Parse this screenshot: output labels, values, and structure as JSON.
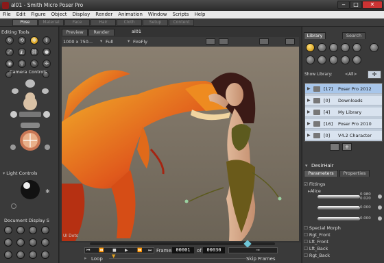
{
  "window": {
    "title": "al01 - Smith Micro Poser Pro",
    "min": "‒",
    "max": "□",
    "close": "✕"
  },
  "menu": [
    "File",
    "Edit",
    "Figure",
    "Object",
    "Display",
    "Render",
    "Animation",
    "Window",
    "Scripts",
    "Help"
  ],
  "rooms": [
    "Pose",
    "Material",
    "Face",
    "Hair",
    "Cloth",
    "Setup",
    "Content"
  ],
  "left": {
    "editing_tools": "Editing Tools",
    "camera_controls": "Camera Controls",
    "light_controls": "Light Controls",
    "document_display": "Document Display S",
    "ui_dots": "UI Dots"
  },
  "center": {
    "tabs": [
      "Preview",
      "Render",
      "al01"
    ],
    "size": "1000 x 750...",
    "fit": "Full",
    "engine": "FireFly"
  },
  "animation": {
    "frame_label": "Frame:",
    "current_frame": "00001",
    "of_label": "of",
    "total_frames": "00030",
    "loop_label": "Loop",
    "skip_frames_label": "Skip Frames",
    "timeline_position": 0.85
  },
  "library": {
    "tabs": [
      "Library",
      "Search"
    ],
    "show_label": "Show Library:",
    "show_value": "<All>",
    "rows": [
      {
        "count": "[17]",
        "name": "Poser Pro 2012",
        "selected": true
      },
      {
        "count": "[0]",
        "name": "Downloads",
        "selected": false
      },
      {
        "count": "[4]",
        "name": "My Library",
        "selected": false
      },
      {
        "count": "[16]",
        "name": "Poser Pro 2010",
        "selected": false
      },
      {
        "count": "[0]",
        "name": "V4.2 Character",
        "selected": false
      }
    ]
  },
  "properties": {
    "title": "DesirHair",
    "tabs": [
      "Parameters",
      "Properties"
    ],
    "group": "Fittings",
    "sub": "Alice",
    "values": [
      "0.980",
      "0.020",
      "0.000",
      "0.000"
    ],
    "sections": [
      "Special Morph",
      "Rgt_Front",
      "Lft_Front",
      "Lft_Back",
      "Rgt_Back"
    ]
  }
}
